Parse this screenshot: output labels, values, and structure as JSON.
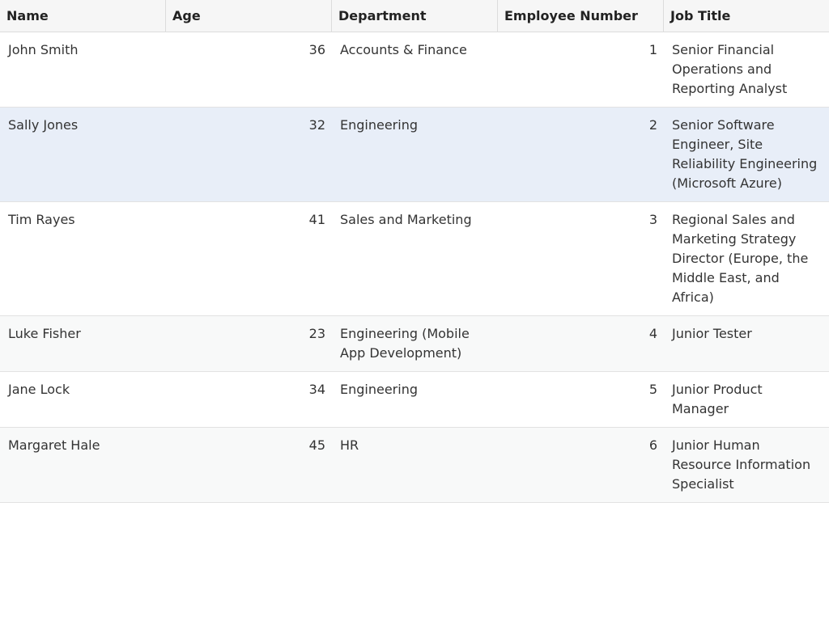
{
  "columns": {
    "name": "Name",
    "age": "Age",
    "department": "Department",
    "employee_number": "Employee Number",
    "job_title": "Job Title"
  },
  "rows": [
    {
      "name": "John Smith",
      "age": "36",
      "department": "Accounts & Finance",
      "employee_number": "1",
      "job_title": "Senior Financial Operations and Reporting Analyst"
    },
    {
      "name": "Sally Jones",
      "age": "32",
      "department": "Engineering",
      "employee_number": "2",
      "job_title": "Senior Software Engineer, Site Reliability Engineering (Microsoft Azure)"
    },
    {
      "name": "Tim Rayes",
      "age": "41",
      "department": "Sales and Marketing",
      "employee_number": "3",
      "job_title": "Regional Sales and Marketing Strategy Director (Europe, the Middle East, and Africa)"
    },
    {
      "name": "Luke Fisher",
      "age": "23",
      "department": "Engineering (Mobile App Development)",
      "employee_number": "4",
      "job_title": "Junior Tester"
    },
    {
      "name": "Jane Lock",
      "age": "34",
      "department": "Engineering",
      "employee_number": "5",
      "job_title": "Junior Product Manager"
    },
    {
      "name": "Margaret Hale",
      "age": "45",
      "department": "HR",
      "employee_number": "6",
      "job_title": "Junior Human Resource Information Specialist"
    }
  ],
  "colors": {
    "header_bg": "#f6f6f6",
    "selected_row_bg": "#e8eef8",
    "alt_row_bg": "#f8f9f9"
  }
}
